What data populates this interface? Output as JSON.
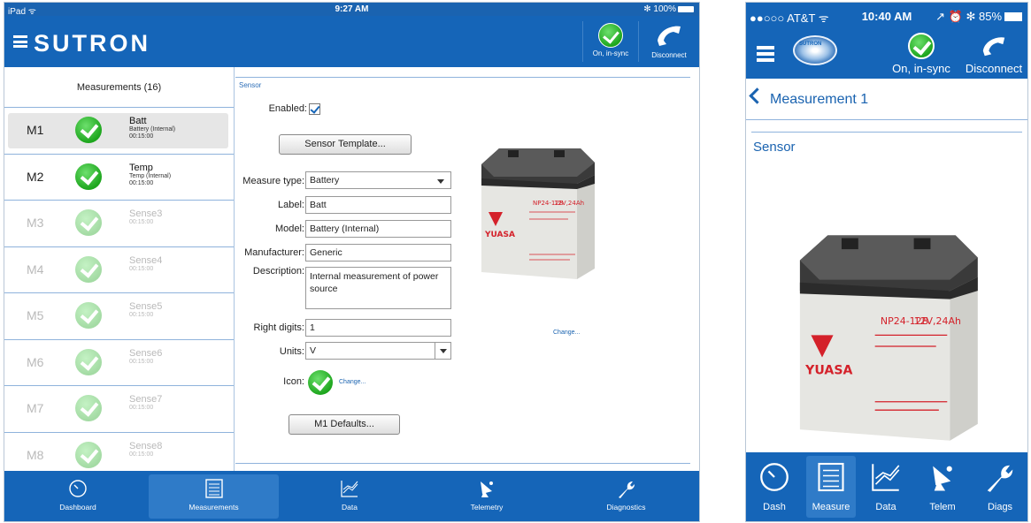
{
  "ipad": {
    "status": {
      "device": "iPad ᯤ",
      "time": "9:27 AM",
      "battery": "✻ 100%"
    },
    "brand": "SUTRON",
    "sync_label": "On, in-sync",
    "disconnect_label": "Disconnect",
    "list_title": "Measurements (16)",
    "measurements": [
      {
        "id": "M1",
        "name": "Batt",
        "model": "Battery (Internal)",
        "interval": "00:15:00"
      },
      {
        "id": "M2",
        "name": "Temp",
        "model": "Temp (Internal)",
        "interval": "00:15:00"
      },
      {
        "id": "M3",
        "name": "Sense3",
        "model": "",
        "interval": "00:15:00"
      },
      {
        "id": "M4",
        "name": "Sense4",
        "model": "",
        "interval": "00:15:00"
      },
      {
        "id": "M5",
        "name": "Sense5",
        "model": "",
        "interval": "00:15:00"
      },
      {
        "id": "M6",
        "name": "Sense6",
        "model": "",
        "interval": "00:15:00"
      },
      {
        "id": "M7",
        "name": "Sense7",
        "model": "",
        "interval": "00:15:00"
      },
      {
        "id": "M8",
        "name": "Sense8",
        "model": "",
        "interval": "00:15:00"
      }
    ],
    "section_label": "Sensor",
    "form": {
      "enabled_label": "Enabled:",
      "sensor_template_button": "Sensor Template...",
      "measure_type_label": "Measure type:",
      "measure_type_value": "Battery",
      "label_label": "Label:",
      "label_value": "Batt",
      "model_label": "Model:",
      "model_value": "Battery (Internal)",
      "manufacturer_label": "Manufacturer:",
      "manufacturer_value": "Generic",
      "description_label": "Description:",
      "description_value": "Internal measurement of power source",
      "right_digits_label": "Right digits:",
      "right_digits_value": "1",
      "units_label": "Units:",
      "units_value": "V",
      "icon_label": "Icon:",
      "icon_change": "Change...",
      "image_change": "Change...",
      "defaults_button": "M1 Defaults..."
    },
    "battery_image": {
      "brand": "YUASA",
      "model": "NP24-12B",
      "rating": "12V,24Ah"
    },
    "tabs": [
      {
        "label": "Dashboard",
        "icon": "dashboard-gauge-icon"
      },
      {
        "label": "Measurements",
        "icon": "measurements-list-icon"
      },
      {
        "label": "Data",
        "icon": "data-chart-icon"
      },
      {
        "label": "Telemetry",
        "icon": "satellite-dish-icon"
      },
      {
        "label": "Diagnostics",
        "icon": "wrench-icon"
      }
    ]
  },
  "iphone": {
    "status": {
      "carrier": "●●○○○ AT&T ᯤ",
      "time": "10:40 AM",
      "right": "↗ ⏰ ✻ 85%"
    },
    "logo_text": "SUTRON",
    "sync_label": "On, in-sync",
    "disconnect_label": "Disconnect",
    "back_label": "Measurement 1",
    "section_label": "Sensor",
    "battery_image": {
      "brand": "YUASA",
      "model": "NP24-12B",
      "rating": "12V,24Ah"
    },
    "tabs": [
      {
        "label": "Dash",
        "icon": "dashboard-gauge-icon"
      },
      {
        "label": "Measure",
        "icon": "measurements-list-icon"
      },
      {
        "label": "Data",
        "icon": "data-chart-icon"
      },
      {
        "label": "Telem",
        "icon": "satellite-dish-icon"
      },
      {
        "label": "Diags",
        "icon": "wrench-icon"
      }
    ]
  },
  "colors": {
    "brand_blue": "#1565b8",
    "active_tab": "#2f7bc8",
    "check_green": "#1ea61e",
    "link_blue": "#1a63b0"
  }
}
